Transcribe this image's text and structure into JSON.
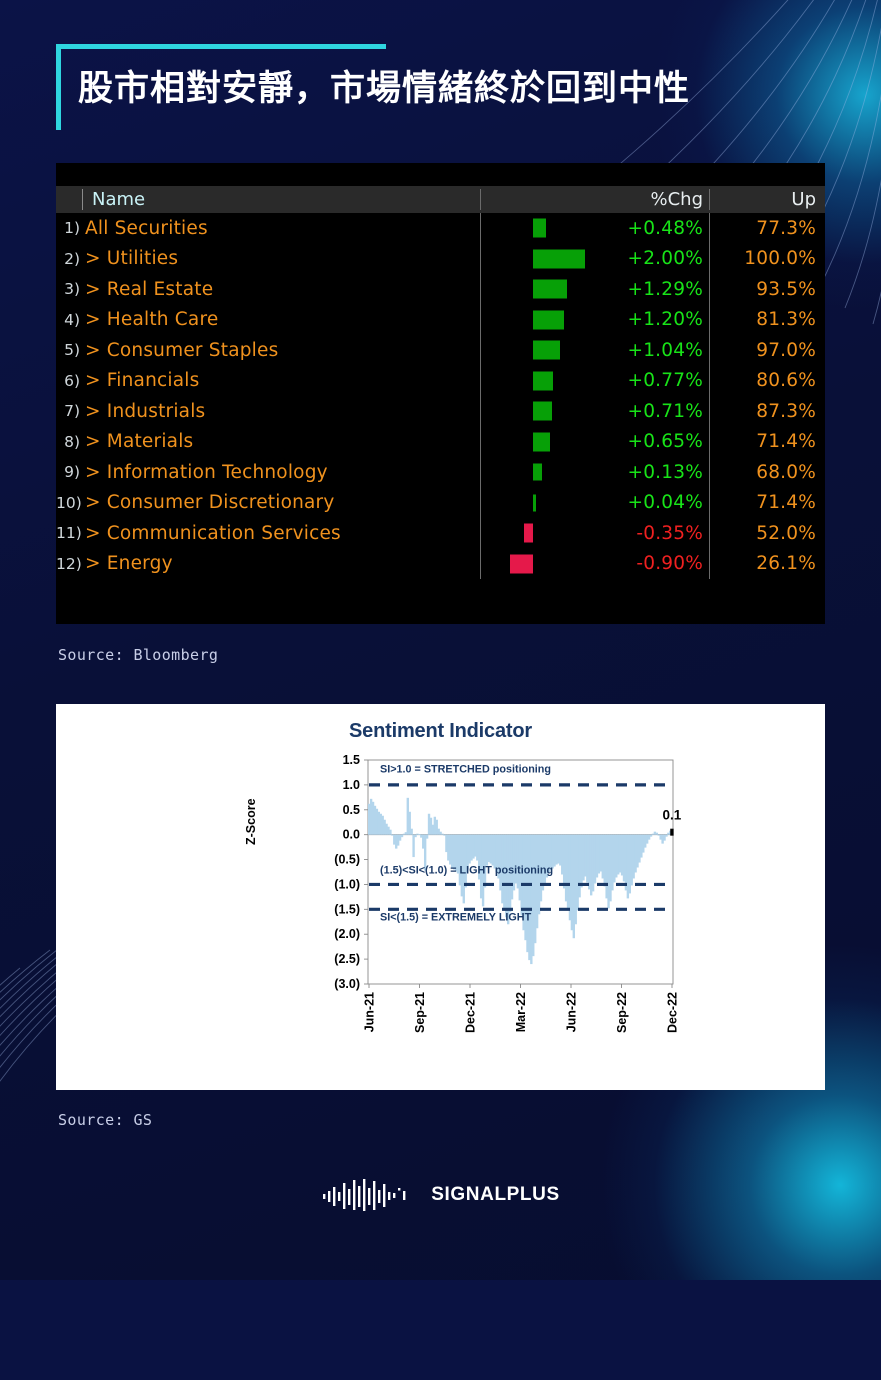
{
  "title": "股市相對安靜，市場情緒終於回到中性",
  "accent_color": "#2fd6e0",
  "bloomberg_panel": {
    "columns": {
      "index": "",
      "name": "Name",
      "pct_chg": "%Chg",
      "up": "Up"
    },
    "rows": [
      {
        "index": "1)",
        "prefix": "",
        "name": "All Securities",
        "pct_chg": "+0.48%",
        "up": "77.3%",
        "value": 0.48,
        "direction": "pos"
      },
      {
        "index": "2)",
        "prefix": "> ",
        "name": "Utilities",
        "pct_chg": "+2.00%",
        "up": "100.0%",
        "value": 2.0,
        "direction": "pos"
      },
      {
        "index": "3)",
        "prefix": "> ",
        "name": "Real Estate",
        "pct_chg": "+1.29%",
        "up": "93.5%",
        "value": 1.29,
        "direction": "pos"
      },
      {
        "index": "4)",
        "prefix": "> ",
        "name": "Health Care",
        "pct_chg": "+1.20%",
        "up": "81.3%",
        "value": 1.2,
        "direction": "pos"
      },
      {
        "index": "5)",
        "prefix": "> ",
        "name": "Consumer Staples",
        "pct_chg": "+1.04%",
        "up": "97.0%",
        "value": 1.04,
        "direction": "pos"
      },
      {
        "index": "6)",
        "prefix": "> ",
        "name": "Financials",
        "pct_chg": "+0.77%",
        "up": "80.6%",
        "value": 0.77,
        "direction": "pos"
      },
      {
        "index": "7)",
        "prefix": "> ",
        "name": "Industrials",
        "pct_chg": "+0.71%",
        "up": "87.3%",
        "value": 0.71,
        "direction": "pos"
      },
      {
        "index": "8)",
        "prefix": "> ",
        "name": "Materials",
        "pct_chg": "+0.65%",
        "up": "71.4%",
        "value": 0.65,
        "direction": "pos"
      },
      {
        "index": "9)",
        "prefix": "> ",
        "name": "Information Technology",
        "pct_chg": "+0.13%",
        "up": "68.0%",
        "value": 0.13,
        "direction": "pos"
      },
      {
        "index": "10)",
        "prefix": "> ",
        "name": "Consumer Discretionary",
        "pct_chg": "+0.04%",
        "up": "71.4%",
        "value": 0.04,
        "direction": "pos"
      },
      {
        "index": "11)",
        "prefix": "> ",
        "name": "Communication Services",
        "pct_chg": "-0.35%",
        "up": "52.0%",
        "value": -0.35,
        "direction": "neg"
      },
      {
        "index": "12)",
        "prefix": "> ",
        "name": "Energy",
        "pct_chg": "-0.90%",
        "up": "26.1%",
        "value": -0.9,
        "direction": "neg"
      }
    ],
    "colors": {
      "name": "#f0921e",
      "positive": "#18e318",
      "negative": "#ef2020",
      "bar_positive": "#07a007",
      "bar_negative": "#e5194a",
      "header_bg": "#2a2a2a",
      "panel_bg": "#000000"
    }
  },
  "source_bloomberg": "Source: Bloomberg",
  "source_gs": "Source: GS",
  "chart_data": {
    "type": "area",
    "title": "Sentiment Indicator",
    "xlabel": "",
    "ylabel": "Z-Score",
    "ylim": [
      -3.0,
      1.5
    ],
    "ytick_labels": [
      "1.5",
      "1.0",
      "0.5",
      "0.0",
      "(0.5)",
      "(1.0)",
      "(1.5)",
      "(2.0)",
      "(2.5)",
      "(3.0)"
    ],
    "ytick_values": [
      1.5,
      1.0,
      0.5,
      0.0,
      -0.5,
      -1.0,
      -1.5,
      -2.0,
      -2.5,
      -3.0
    ],
    "xtick_labels": [
      "Jun-21",
      "Sep-21",
      "Dec-21",
      "Mar-22",
      "Jun-22",
      "Sep-22",
      "Dec-22"
    ],
    "grid": false,
    "legend": "none",
    "series_name": "Sentiment Indicator (SI)",
    "series_color": "#b3d5ec",
    "last_value_label": "0.1",
    "last_value": 0.1,
    "reference_lines": [
      {
        "value": 1.0,
        "style": "dashed",
        "color": "#1b3a68"
      },
      {
        "value": -1.0,
        "style": "dashed",
        "color": "#1b3a68"
      },
      {
        "value": -1.5,
        "style": "dashed",
        "color": "#1b3a68"
      }
    ],
    "annotations": [
      {
        "text": "SI>1.0 = STRETCHED positioning",
        "y": 1.25,
        "color": "#1b3a68"
      },
      {
        "text": "(1.5)<SI<(1.0) = LIGHT positioning",
        "y": -0.78,
        "color": "#1b3a68"
      },
      {
        "text": "SI<(1.5) = EXTREMELY LIGHT",
        "y": -1.72,
        "color": "#1b3a68"
      }
    ],
    "values": [
      0.62,
      0.72,
      0.66,
      0.58,
      0.52,
      0.46,
      0.42,
      0.38,
      0.3,
      0.22,
      0.16,
      0.1,
      -0.02,
      -0.2,
      -0.28,
      -0.22,
      -0.12,
      -0.05,
      0.02,
      0.05,
      0.74,
      0.46,
      0.12,
      -0.45,
      -0.05,
      0.02,
      0.01,
      -0.06,
      -0.28,
      -0.72,
      -0.08,
      0.42,
      0.34,
      0.2,
      0.36,
      0.3,
      0.12,
      0.06,
      0.02,
      -0.02,
      -0.35,
      -0.52,
      -0.6,
      -0.66,
      -0.7,
      -0.74,
      -0.78,
      -1.02,
      -1.24,
      -1.38,
      -1.06,
      -0.7,
      -0.58,
      -0.52,
      -0.48,
      -0.44,
      -0.52,
      -0.9,
      -1.28,
      -1.44,
      -1.06,
      -0.62,
      -0.55,
      -0.58,
      -0.62,
      -0.68,
      -0.75,
      -0.88,
      -1.12,
      -1.38,
      -1.52,
      -1.66,
      -1.8,
      -1.55,
      -1.3,
      -1.12,
      -0.98,
      -1.08,
      -1.32,
      -1.62,
      -1.92,
      -2.12,
      -2.36,
      -2.52,
      -2.6,
      -2.44,
      -2.18,
      -1.88,
      -1.6,
      -1.34,
      -1.12,
      -0.98,
      -0.86,
      -0.78,
      -0.72,
      -0.68,
      -0.64,
      -0.6,
      -0.58,
      -0.62,
      -0.8,
      -1.08,
      -1.34,
      -1.52,
      -1.72,
      -1.92,
      -2.08,
      -1.8,
      -1.52,
      -1.26,
      -1.06,
      -0.92,
      -0.84,
      -0.96,
      -1.1,
      -1.22,
      -1.14,
      -0.98,
      -0.86,
      -0.78,
      -0.74,
      -0.88,
      -1.04,
      -1.28,
      -1.48,
      -1.34,
      -1.12,
      -0.96,
      -0.86,
      -0.8,
      -0.76,
      -0.82,
      -0.94,
      -1.12,
      -1.28,
      -1.18,
      -1.02,
      -0.88,
      -0.76,
      -0.66,
      -0.56,
      -0.46,
      -0.36,
      -0.26,
      -0.18,
      -0.1,
      -0.04,
      0.02,
      0.06,
      0.04,
      -0.02,
      -0.1,
      -0.18,
      -0.12,
      -0.04,
      0.04,
      0.08,
      0.1
    ]
  },
  "footer": {
    "logo_text": "SIGNALPLUS",
    "logo_icon": "waveform-icon"
  }
}
